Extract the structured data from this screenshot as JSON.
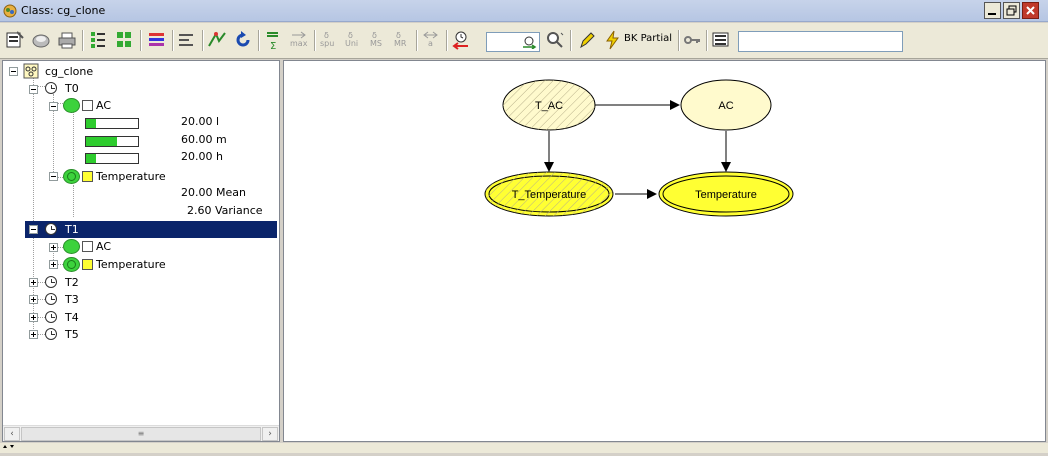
{
  "window": {
    "title": "Class: cg_clone"
  },
  "toolbar": {
    "bk_label": "BK Partial",
    "mini_labels": {
      "max": "max",
      "spu": "spu",
      "uni": "Uni",
      "ms": "MS",
      "mr": "MR",
      "a": "a"
    },
    "spin_value": "",
    "search_value": ""
  },
  "tree": {
    "root_label": "cg_clone",
    "t0_label": "T0",
    "ac_label": "AC",
    "ac_states": [
      {
        "value": "20.00 l",
        "fill": 0.2
      },
      {
        "value": "60.00 m",
        "fill": 0.6
      },
      {
        "value": "20.00 h",
        "fill": 0.2
      }
    ],
    "temp_label": "Temperature",
    "temp_mean": "20.00 Mean",
    "temp_variance": "2.60 Variance",
    "t1_label": "T1",
    "t1_ac_label": "AC",
    "t1_temp_label": "Temperature",
    "t2_label": "T2",
    "t3_label": "T3",
    "t4_label": "T4",
    "t5_label": "T5"
  },
  "graph": {
    "nodes": {
      "t_ac": "T_AC",
      "ac": "AC",
      "t_temp": "T_Temperature",
      "temp": "Temperature"
    }
  },
  "colors": {
    "discrete_node": "#fffacd",
    "continuous_node": "#ffff33",
    "selection": "#0a246a"
  }
}
